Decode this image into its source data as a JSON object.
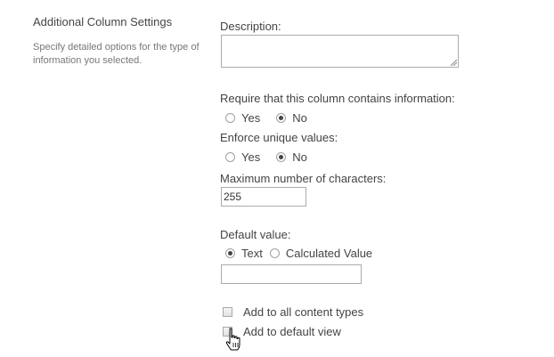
{
  "section": {
    "title": "Additional Column Settings",
    "description": "Specify detailed options for the type of information you selected."
  },
  "fields": {
    "description_label": "Description:",
    "description_value": "",
    "require": {
      "label": "Require that this column contains information:",
      "yes": "Yes",
      "no": "No",
      "selected": "No"
    },
    "unique": {
      "label": "Enforce unique values:",
      "yes": "Yes",
      "no": "No",
      "selected": "No"
    },
    "max_chars": {
      "label": "Maximum number of characters:",
      "value": "255"
    },
    "default_value": {
      "label": "Default value:",
      "option_text": "Text",
      "option_calculated": "Calculated Value",
      "selected": "Text",
      "value": ""
    },
    "add_all_content_types": {
      "label": "Add to all content types",
      "checked": false
    },
    "add_default_view": {
      "label": "Add to default view",
      "checked": false
    }
  },
  "icons": {
    "cursor": "hand-pointer-icon",
    "resize": "resize-grip-icon"
  }
}
